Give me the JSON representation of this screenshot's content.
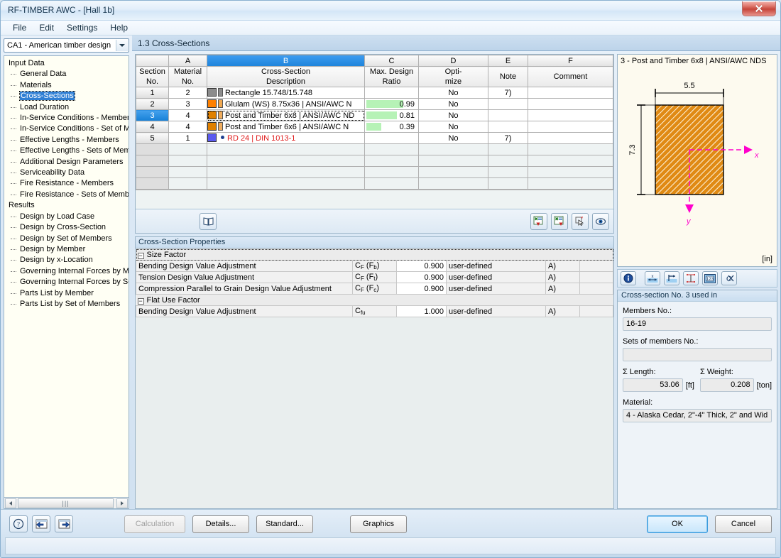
{
  "window": {
    "title": "RF-TIMBER AWC - [Hall 1b]",
    "close_label": "Close"
  },
  "menu": {
    "items": [
      {
        "label": "File"
      },
      {
        "label": "Edit"
      },
      {
        "label": "Settings"
      },
      {
        "label": "Help"
      }
    ]
  },
  "sidebar": {
    "combo_value": "CA1 - American timber design",
    "groups": [
      {
        "label": "Input Data",
        "items": [
          {
            "label": "General Data",
            "selected": false
          },
          {
            "label": "Materials",
            "selected": false
          },
          {
            "label": "Cross-Sections",
            "selected": true
          },
          {
            "label": "Load Duration",
            "selected": false
          },
          {
            "label": "In-Service Conditions - Members",
            "selected": false
          },
          {
            "label": "In-Service Conditions - Set of M",
            "selected": false
          },
          {
            "label": "Effective Lengths - Members",
            "selected": false
          },
          {
            "label": "Effective Lengths - Sets of Mem",
            "selected": false
          },
          {
            "label": "Additional Design Parameters",
            "selected": false
          },
          {
            "label": "Serviceability Data",
            "selected": false
          },
          {
            "label": "Fire Resistance - Members",
            "selected": false
          },
          {
            "label": "Fire Resistance - Sets of Memb",
            "selected": false
          }
        ]
      },
      {
        "label": "Results",
        "items": [
          {
            "label": "Design by Load Case",
            "selected": false
          },
          {
            "label": "Design by Cross-Section",
            "selected": false
          },
          {
            "label": "Design by Set of Members",
            "selected": false
          },
          {
            "label": "Design by Member",
            "selected": false
          },
          {
            "label": "Design by x-Location",
            "selected": false
          },
          {
            "label": "Governing Internal Forces by M",
            "selected": false
          },
          {
            "label": "Governing Internal Forces by Se",
            "selected": false
          },
          {
            "label": "Parts List by Member",
            "selected": false
          },
          {
            "label": "Parts List by Set of Members",
            "selected": false
          }
        ]
      }
    ]
  },
  "tab": {
    "title": "1.3 Cross-Sections"
  },
  "table": {
    "column_letters": [
      "",
      "A",
      "B",
      "C",
      "D",
      "E",
      "F"
    ],
    "active_column": "B",
    "headers": [
      {
        "line1": "Section",
        "line2": "No."
      },
      {
        "line1": "Material",
        "line2": "No."
      },
      {
        "line1": "Cross-Section",
        "line2": "Description"
      },
      {
        "line1": "Max. Design",
        "line2": "Ratio"
      },
      {
        "line1": "Opti-",
        "line2": "mize"
      },
      {
        "line1": "",
        "line2": "Note"
      },
      {
        "line1": "",
        "line2": "Comment"
      }
    ],
    "rows": [
      {
        "section_no": "1",
        "material_no": "2",
        "description": "Rectangle 15.748/15.748",
        "swatch_color": "#8c8c8c",
        "swatch2_color": "#8c8c8c",
        "marker": "square",
        "ratio": "",
        "ratio_pct": 0,
        "optimize": "No",
        "note": "7)",
        "comment": "",
        "selected": false,
        "red_text": false
      },
      {
        "section_no": "2",
        "material_no": "3",
        "description": "Glulam (WS) 8.75x36 | ANSI/AWC N",
        "swatch_color": "#ff8000",
        "swatch2_color": "#f0a851",
        "marker": "square",
        "ratio": "0.99",
        "ratio_pct": 99,
        "optimize": "No",
        "note": "",
        "comment": "",
        "selected": false,
        "red_text": false
      },
      {
        "section_no": "3",
        "material_no": "4",
        "description": "Post and Timber 6x8 | ANSI/AWC ND",
        "swatch_color": "#e08000",
        "swatch2_color": "#f0ad5e",
        "marker": "square",
        "ratio": "0.81",
        "ratio_pct": 81,
        "optimize": "No",
        "note": "",
        "comment": "",
        "selected": true,
        "red_text": false
      },
      {
        "section_no": "4",
        "material_no": "4",
        "description": "Post and Timber 6x6 | ANSI/AWC N",
        "swatch_color": "#e08000",
        "swatch2_color": "#f0ad5e",
        "marker": "square",
        "ratio": "0.39",
        "ratio_pct": 39,
        "optimize": "No",
        "note": "",
        "comment": "",
        "selected": false,
        "red_text": false
      },
      {
        "section_no": "5",
        "material_no": "1",
        "description": "RD 24 | DIN 1013-1",
        "swatch_color": "#5b5bef",
        "swatch2_color": "",
        "marker": "dot",
        "ratio": "",
        "ratio_pct": 0,
        "optimize": "No",
        "note": "7)",
        "comment": "",
        "selected": false,
        "red_text": true
      }
    ],
    "toolbar": {
      "library_icon": "book-icon",
      "import_icon": "import-red-icon",
      "export_icon": "export-green-icon",
      "pick_icon": "pick-section-icon",
      "view_icon": "eye-icon"
    }
  },
  "properties": {
    "title": "Cross-Section Properties",
    "groups": [
      {
        "label": "Size Factor",
        "expanded": true,
        "rows": [
          {
            "label": "Bending Design Value Adjustment",
            "symbol_main": "C",
            "symbol_sub": "F",
            "symbol_paren": "F",
            "symbol_paren_sub": "b",
            "value": "0.900",
            "source": "user-defined",
            "note": "A)",
            "comment": ""
          },
          {
            "label": "Tension Design Value Adjustment",
            "symbol_main": "C",
            "symbol_sub": "F",
            "symbol_paren": "F",
            "symbol_paren_sub": "t",
            "value": "0.900",
            "source": "user-defined",
            "note": "A)",
            "comment": ""
          },
          {
            "label": "Compression Parallel to Grain Design Value Adjustment",
            "symbol_main": "C",
            "symbol_sub": "F",
            "symbol_paren": "F",
            "symbol_paren_sub": "c",
            "value": "0.900",
            "source": "user-defined",
            "note": "A)",
            "comment": ""
          }
        ]
      },
      {
        "label": "Flat Use Factor",
        "expanded": true,
        "rows": [
          {
            "label": "Bending Design Value Adjustment",
            "symbol_main": "C",
            "symbol_sub": "fu",
            "symbol_paren": "",
            "symbol_paren_sub": "",
            "value": "1.000",
            "source": "user-defined",
            "note": "A)",
            "comment": ""
          }
        ]
      }
    ]
  },
  "graphic": {
    "title": "3 - Post and Timber 6x8 | ANSI/AWC NDS",
    "width_dim": "5.5",
    "height_dim": "7.3",
    "axis_x_label": "x",
    "axis_y_label": "y",
    "unit": "[in]",
    "fill_color": "#e08a14",
    "axis_color": "#ff00cc",
    "toolbar_icons": [
      {
        "name": "info-icon"
      },
      {
        "name": "x-dimension-icon"
      },
      {
        "name": "axis-icon"
      },
      {
        "name": "dimension-lines-icon"
      },
      {
        "name": "numbers-icon"
      },
      {
        "name": "hide-dimensions-icon"
      }
    ]
  },
  "info_panel": {
    "header": "Cross-section No. 3 used in",
    "members_label": "Members No.:",
    "members_value": "16-19",
    "sets_label": "Sets of members No.:",
    "sets_value": "",
    "length_label": "Σ Length:",
    "length_value": "53.06",
    "length_unit": "[ft]",
    "weight_label": "Σ Weight:",
    "weight_value": "0.208",
    "weight_unit": "[ton]",
    "material_label": "Material:",
    "material_value": "4 - Alaska Cedar, 2\"-4\" Thick, 2\" and Wid"
  },
  "bottom": {
    "help_icon": "help-icon",
    "prev_icon": "previous-icon",
    "next_icon": "next-icon",
    "calculation": "Calculation",
    "details": "Details...",
    "standard": "Standard...",
    "graphics": "Graphics",
    "ok": "OK",
    "cancel": "Cancel"
  }
}
